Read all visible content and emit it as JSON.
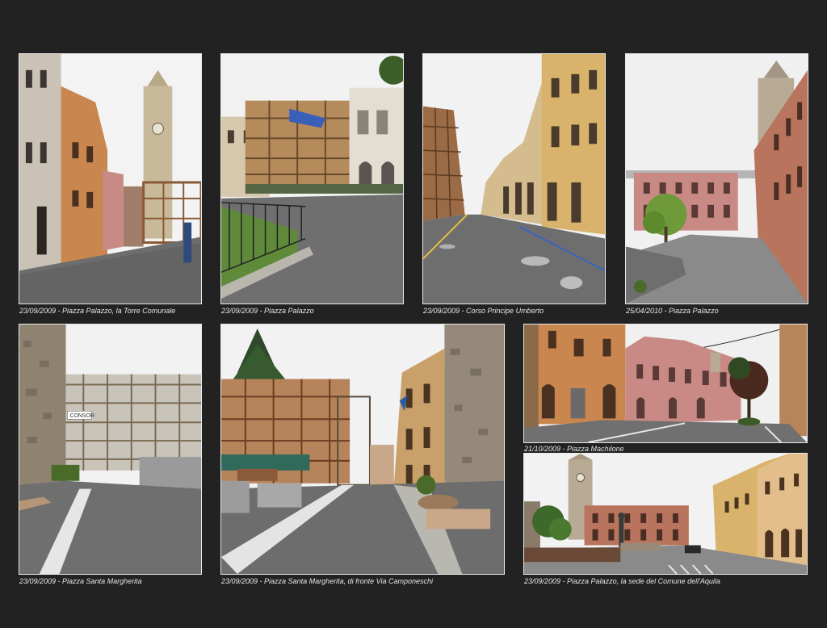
{
  "captions": {
    "p1": "23/09/2009 - Piazza Palazzo, la Torre Comunale",
    "p2": "23/09/2009 - Piazza Palazzo",
    "p3": "23/09/2009 - Corso Principe Umberto",
    "p4": "25/04/2010 - Piazza Palazzo",
    "p5": "23/09/2009 - Piazza Santa Margherita",
    "p6": "23/09/2009 - Piazza Santa Margherita, di fronte Via Camponeschi",
    "p7": "21/10/2009 - Piazza Machilone",
    "p8": "23/09/2009 - Piazza Palazzo, la sede del Comune dell'Aquila"
  },
  "signs": {
    "scaffold_banner": "CONSOR"
  },
  "colors": {
    "background": "#222223",
    "frame": "#e9e9e9",
    "caption_text": "#e6e6e6",
    "sky": "#f2f2f2",
    "cobblestone": "#6e6e6e",
    "ochre_building": "#c9864f",
    "pink_building": "#c98a86",
    "yellow_building": "#d9b36b",
    "scaffold": "#8a5a34"
  }
}
